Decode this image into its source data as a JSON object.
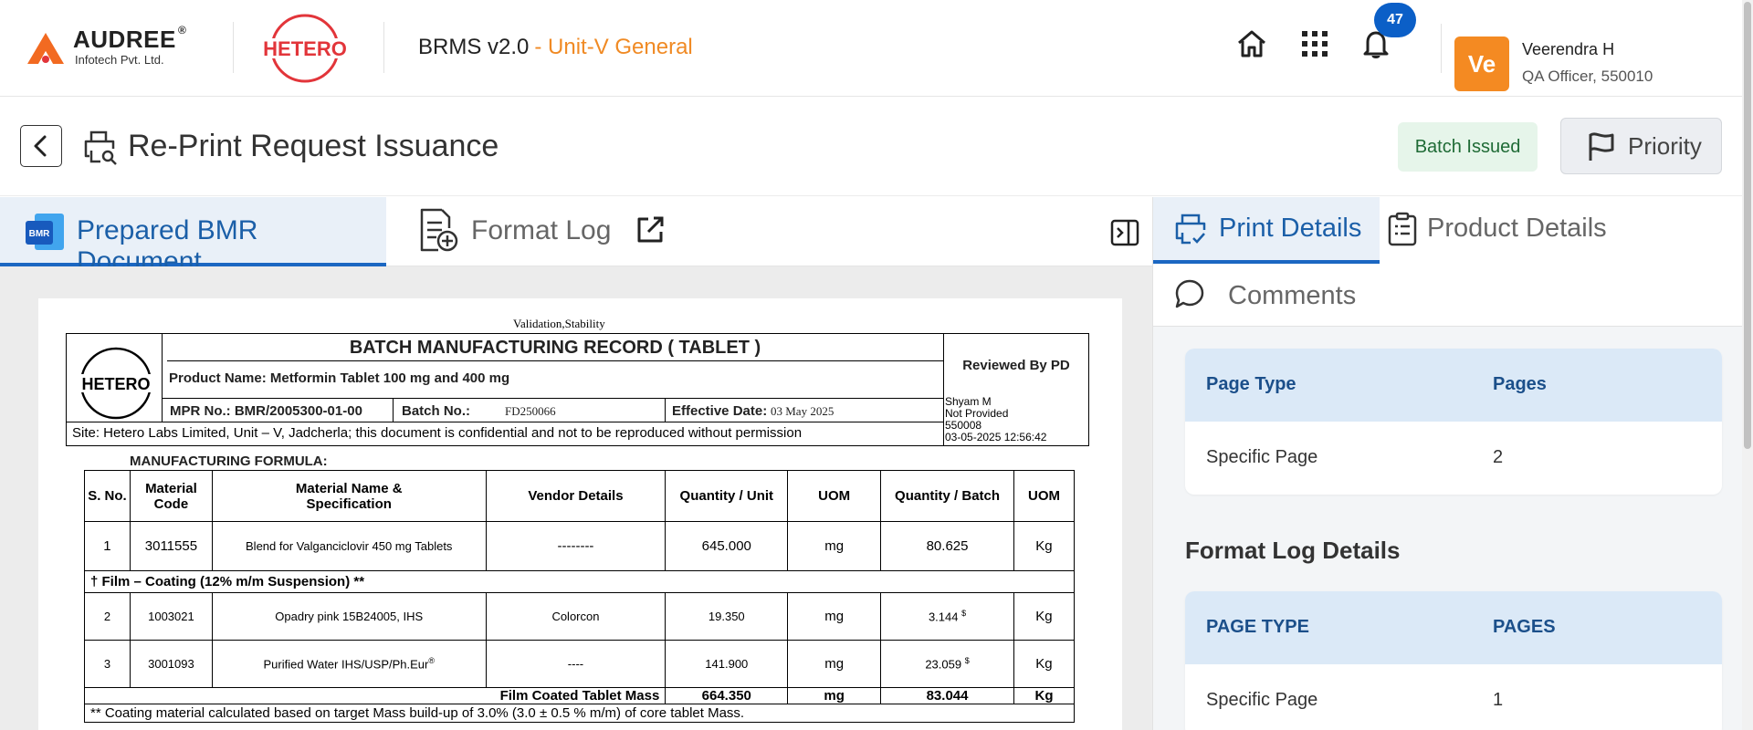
{
  "header": {
    "company_name": "AUDREE",
    "company_reg": "®",
    "company_sub": "Infotech Pvt. Ltd.",
    "client_logo_text": "HETERO",
    "app_name": "BRMS v2.0",
    "unit": "- Unit-V General",
    "notification_count": "47",
    "user": {
      "initials": "Ve",
      "name": "Veerendra H",
      "role": "QA Officer, 550010"
    },
    "accent_color": "#f48a22",
    "badge_color": "#0b5fc7"
  },
  "page": {
    "title": "Re-Print Request Issuance",
    "status": "Batch Issued",
    "priority_label": "Priority"
  },
  "left_tabs": {
    "bmr_icon_text": "BMR",
    "prepared": "Prepared BMR Document",
    "format_log": "Format Log"
  },
  "document": {
    "top_note": "Validation,Stability",
    "logo_text": "HETERO",
    "title": "BATCH MANUFACTURING RECORD ( TABLET )",
    "product_name": "Product Name: Metformin Tablet 100 mg and 400 mg",
    "reviewed_by": "Reviewed By PD",
    "mpr_no": "MPR No.: BMR/2005300-01-00",
    "batch_label": "Batch No.:",
    "batch_value": "FD250066",
    "effective_label": "Effective Date:",
    "effective_value": "03 May 2025",
    "sign": {
      "name": "Shyam M",
      "status": "Not Provided",
      "id": "550008",
      "datetime": "03-05-2025 12:56:42"
    },
    "site": "Site: Hetero Labs Limited, Unit – V, Jadcherla; this document is confidential and not to be reproduced without permission",
    "formula_label": "MANUFACTURING FORMULA:",
    "table": {
      "headers": [
        "S. No.",
        "Material Code",
        "Material Name & Specification",
        "Vendor Details",
        "Quantity / Unit",
        "UOM",
        "Quantity / Batch",
        "UOM"
      ],
      "header_line1": {
        "code": "Material",
        "name": "Material Name &"
      },
      "header_line2": {
        "code": "Code",
        "name": "Specification"
      },
      "row1": [
        "1",
        "3011555",
        "Blend for Valganciclovir 450 mg Tablets",
        "--------",
        "645.000",
        "mg",
        "80.625",
        "Kg"
      ],
      "section": "† Film – Coating (12% m/m Suspension) **",
      "row2": [
        "2",
        "1003021",
        "Opadry pink 15B24005, IHS",
        "Colorcon",
        "19.350",
        "mg",
        "3.144",
        "Kg"
      ],
      "row3": [
        "3",
        "3001093",
        "Purified Water IHS/USP/Ph.Eur",
        "----",
        "141.900",
        "mg",
        "23.059",
        "Kg"
      ],
      "row3_mark": "®",
      "sup_mark": "$",
      "total": [
        "Film Coated Tablet Mass",
        "664.350",
        "mg",
        "83.044",
        "Kg"
      ],
      "note": "** Coating material calculated based on target Mass build-up of 3.0% (3.0 ± 0.5 % m/m) of core tablet Mass."
    }
  },
  "right_panel": {
    "tabs": [
      "Print Details",
      "Product Details"
    ],
    "comments_tab": "Comments",
    "print_table": {
      "headers": [
        "Page Type",
        "Pages"
      ],
      "rows": [
        [
          "Specific Page",
          "2"
        ]
      ]
    },
    "format_log_title": "Format Log Details",
    "format_log_table": {
      "headers": [
        "PAGE TYPE",
        "PAGES"
      ],
      "rows": [
        [
          "Specific Page",
          "1"
        ]
      ]
    }
  }
}
